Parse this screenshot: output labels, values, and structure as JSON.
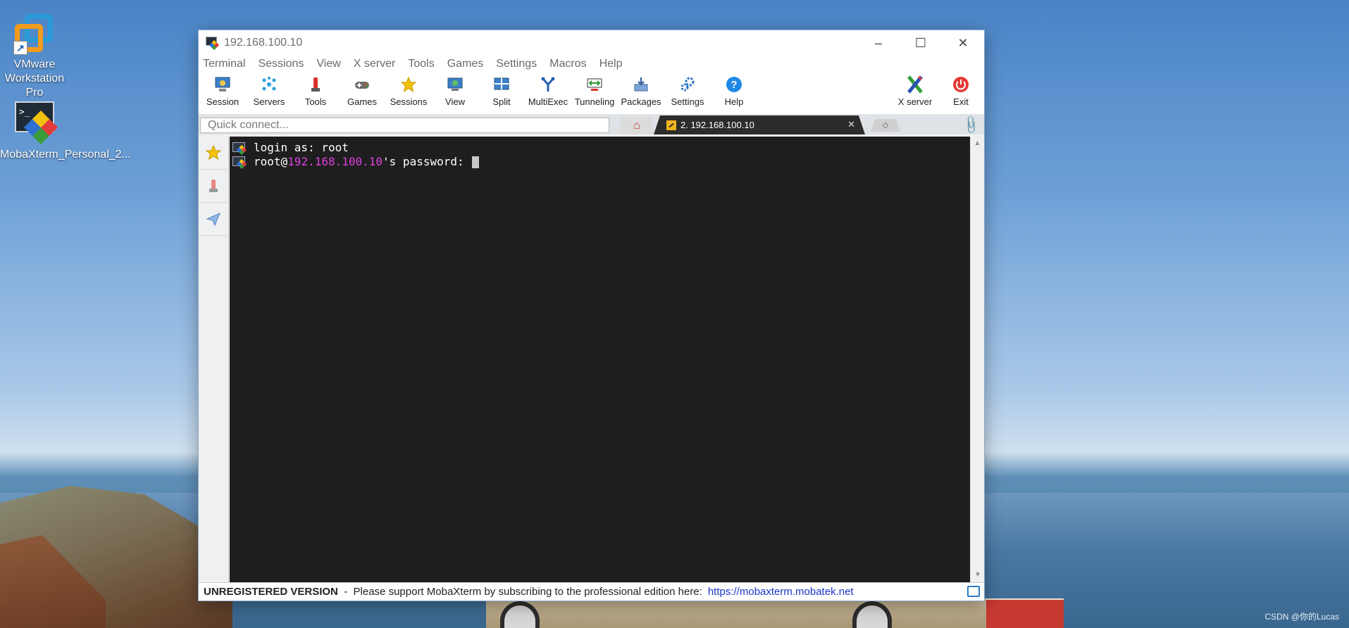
{
  "desktop": {
    "icons": [
      {
        "label": "VMware Workstation Pro"
      },
      {
        "label": "MobaXterm_Personal_2..."
      }
    ],
    "watermark": "CSDN @你的Lucas"
  },
  "window": {
    "title": "192.168.100.10",
    "controls": {
      "minimize": "–",
      "maximize": "☐",
      "close": "✕"
    }
  },
  "menu": [
    "Terminal",
    "Sessions",
    "View",
    "X server",
    "Tools",
    "Games",
    "Settings",
    "Macros",
    "Help"
  ],
  "toolbar": {
    "buttons": [
      {
        "label": "Session",
        "icon": "session-icon"
      },
      {
        "label": "Servers",
        "icon": "servers-icon"
      },
      {
        "label": "Tools",
        "icon": "tools-icon"
      },
      {
        "label": "Games",
        "icon": "games-icon"
      },
      {
        "label": "Sessions",
        "icon": "star-icon"
      },
      {
        "label": "View",
        "icon": "view-icon"
      },
      {
        "label": "Split",
        "icon": "split-icon"
      },
      {
        "label": "MultiExec",
        "icon": "multiexec-icon"
      },
      {
        "label": "Tunneling",
        "icon": "tunneling-icon"
      },
      {
        "label": "Packages",
        "icon": "packages-icon"
      },
      {
        "label": "Settings",
        "icon": "settings-icon"
      },
      {
        "label": "Help",
        "icon": "help-icon"
      }
    ],
    "right_buttons": [
      {
        "label": "X server",
        "icon": "x-server-icon"
      },
      {
        "label": "Exit",
        "icon": "power-icon"
      }
    ]
  },
  "tabs": {
    "quick_connect_placeholder": "Quick connect...",
    "active_tab_label": "2. 192.168.100.10",
    "close_glyph": "✕"
  },
  "terminal": {
    "line1": "login as: root",
    "line2_prefix": "root@",
    "line2_host": "192.168.100.10",
    "line2_suffix": "'s password: "
  },
  "status": {
    "bold": "UNREGISTERED VERSION",
    "text": "  -  Please support MobaXterm by subscribing to the professional edition here:",
    "link": "https://mobaxterm.mobatek.net"
  },
  "colors": {
    "terminal_bg": "#1e1e1e",
    "host_highlight": "#e040e0",
    "link": "#1a35c8"
  }
}
